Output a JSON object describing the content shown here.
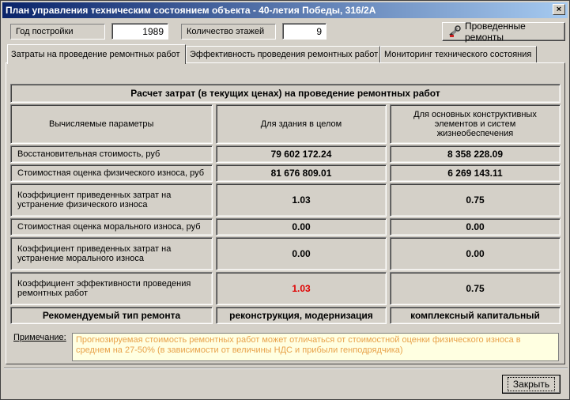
{
  "window": {
    "title": "План управления техническим состоянием объекта - 40-летия Победы, 316/2А",
    "close_glyph": "×"
  },
  "header": {
    "year_label": "Год постройки",
    "year_value": "1989",
    "floors_label": "Количество этажей",
    "floors_value": "9",
    "repairs_button": "Проведенные ремонты"
  },
  "tabs": [
    {
      "label": "Затраты на проведение ремонтных работ",
      "active": true
    },
    {
      "label": "Эффективность проведения ремонтных работ",
      "active": false
    },
    {
      "label": "Мониторинг технического состояния",
      "active": false
    }
  ],
  "table": {
    "title": "Расчет затрат (в текущих ценах) на проведение ремонтных работ",
    "headers": {
      "params": "Вычисляемые параметры",
      "building": "Для здания в целом",
      "elements": "Для основных конструктивных элементов и систем жизнеобеспечения"
    },
    "rows": [
      {
        "param": "Восстановительная стоимость, руб",
        "building": "79 602 172.24",
        "elements": "8 358 228.09"
      },
      {
        "param": "Стоимостная оценка физического износа, руб",
        "building": "81 676 809.01",
        "elements": "6 269 143.11"
      },
      {
        "param": "Коэффициент приведенных затрат на устранение физического износа",
        "building": "1.03",
        "elements": "0.75"
      },
      {
        "param": "Стоимостная оценка морального износа, руб",
        "building": "0.00",
        "elements": "0.00"
      },
      {
        "param": "Коэффициент приведенных затрат на устранение морального износа",
        "building": "0.00",
        "elements": "0.00"
      },
      {
        "param": "Коэффициент эффективности проведения ремонтных работ",
        "building": "1.03",
        "elements": "0.75"
      }
    ],
    "recommend": {
      "label": "Рекомендуемый тип ремонта",
      "building": "реконструкция, модернизация",
      "elements": "комплексный капитальный"
    }
  },
  "note": {
    "label": "Примечание:",
    "text": "Прогнозируемая стоимость ремонтных работ может отличаться от стоимостной оценки физического износа в среднем на 27-50% (в зависимости от величины НДС и прибыли генподрядчика)"
  },
  "footer": {
    "close_button": "Закрыть"
  },
  "colors": {
    "highlight_value": "#e00000",
    "note_text": "#e8a24a",
    "note_bg": "#ffffe1"
  }
}
